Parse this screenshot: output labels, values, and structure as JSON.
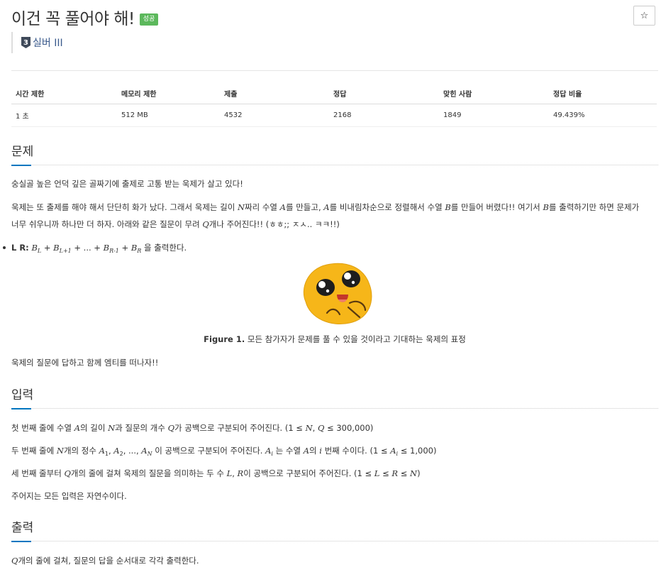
{
  "problem": {
    "title": "이건 꼭 풀어야 해!",
    "result_badge": "성공",
    "star": "☆",
    "tier_number": "3",
    "tier_label": "실버 III"
  },
  "info_table": {
    "headers": [
      "시간 제한",
      "메모리 제한",
      "제출",
      "정답",
      "맞힌 사람",
      "정답 비율"
    ],
    "values": [
      "1 초",
      "512 MB",
      "4532",
      "2168",
      "1849",
      "49.439%"
    ]
  },
  "sections": {
    "problem_title": "문제",
    "input_title": "입력",
    "output_title": "출력"
  },
  "statement": {
    "p1": "숭실골 높은 언덕 깊은 골짜기에 출제로 고통 받는 욱제가 살고 있다!",
    "p2_a": "욱제는 또 출제를 해야 해서 단단히 화가 났다. 그래서 욱제는 길이 ",
    "p2_N": "N",
    "p2_b": "짜리 수열 ",
    "p2_A": "A",
    "p2_c": "를 만들고, ",
    "p2_A2": "A",
    "p2_d": "를 비내림차순으로 정렬해서 수열 ",
    "p2_B": "B",
    "p2_e": "를 만들어 버렸다!! 여기서 ",
    "p2_B2": "B",
    "p2_f": "를 출력하기만 하면 문제가",
    "p3_a": "너무 쉬우니까 하나만 더 하자. 아래와 같은 질문이 무려 ",
    "p3_Q": "Q",
    "p3_b": "개나 주어진다!! (ㅎㅎ;; ㅈㅅ.. ㅋㅋ!!)",
    "bullet_lr": "L R:",
    "bullet_tail": "을 출력한다.",
    "caption_bold": "Figure 1.",
    "caption_text": " 모든 참가자가 문제를 풀 수 있을 것이라고 기대하는 욱제의 표정",
    "p4": "욱제의 질문에 답하고 함께 엠티를 떠나자!!"
  },
  "input": {
    "l1_a": "첫 번째 줄에 수열 ",
    "l1_b": "의 길이 ",
    "l1_c": "과 질문의 개수 ",
    "l1_d": "가 공백으로 구분되어 주어진다. (1 ≤ ",
    "l1_e": " ≤ 300,000)",
    "l2_a": "두 번째 줄에 ",
    "l2_b": "개의 정수 ",
    "l2_c": " 이 공백으로 구분되어 주어진다. ",
    "l2_d": " 는 수열 ",
    "l2_e": "의 ",
    "l2_f": " 번째 수이다. (1 ≤ ",
    "l2_g": " ≤ 1,000)",
    "l3_a": "세 번째 줄부터 ",
    "l3_b": "개의 줄에 걸쳐 욱제의 질문을 의미하는 두 수 ",
    "l3_c": "이 공백으로 구분되어 주어진다. (1 ≤ ",
    "l3_d": ")",
    "l4": "주어지는 모든 입력은 자연수이다."
  },
  "output": {
    "l1_a": "Q",
    "l1_b": "개의 줄에 걸쳐, 질문의 답을 순서대로 각각 출력한다."
  },
  "colors": {
    "success": "#5cb85c",
    "accent": "#0076c0",
    "tier": "#3a5a8c"
  }
}
